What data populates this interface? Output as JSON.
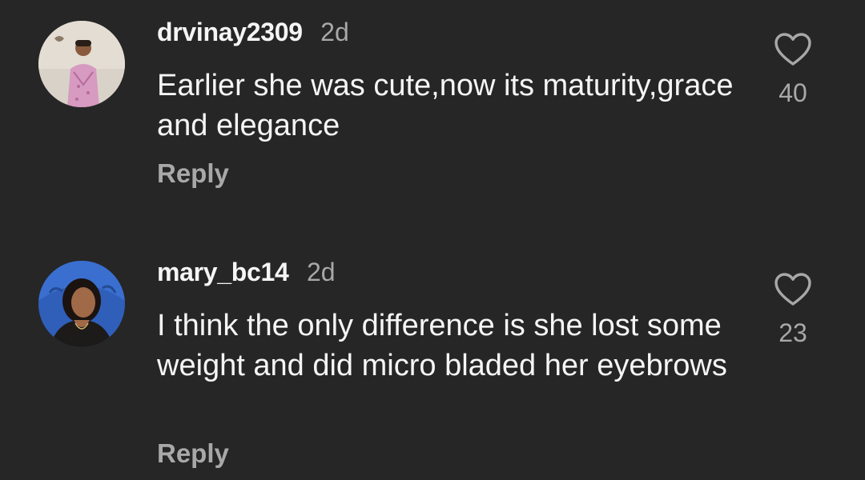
{
  "comments": [
    {
      "username": "drvinay2309",
      "time": "2d",
      "text": "Earlier she was cute,now its maturity,grace and elegance",
      "reply_label": "Reply",
      "likes": "40"
    },
    {
      "username": "mary_bc14",
      "time": "2d",
      "text": "I think the only difference is she lost some weight and did micro bladed her eyebrows",
      "reply_label": "Reply",
      "likes": "23"
    }
  ],
  "icons": {
    "like": "heart-outline-icon"
  },
  "colors": {
    "background": "#262626",
    "primary_text": "#f5f5f5",
    "secondary_text": "#a8a8a8"
  }
}
